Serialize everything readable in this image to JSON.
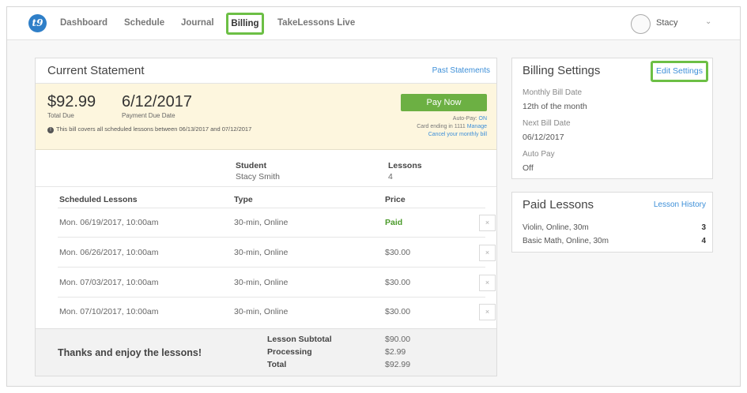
{
  "nav": {
    "logo": "t9",
    "items": [
      "Dashboard",
      "Schedule",
      "Journal",
      "Billing",
      "TakeLessons Live"
    ],
    "user": "Stacy"
  },
  "statement": {
    "title": "Current Statement",
    "past_link": "Past Statements",
    "total": "$92.99",
    "total_label": "Total Due",
    "due_date": "6/12/2017",
    "due_label": "Payment Due Date",
    "info": "This bill covers all scheduled lessons between 06/13/2017 and 07/12/2017",
    "pay_button": "Pay Now",
    "autopay_label": "Auto-Pay:",
    "autopay_state": "ON",
    "card_text": "Card ending in 1111",
    "manage": "Manage",
    "cancel": "Cancel your monthly bill",
    "student_label": "Student",
    "student_value": "Stacy Smith",
    "lessons_label": "Lessons",
    "lessons_value": "4",
    "columns": [
      "Scheduled Lessons",
      "Type",
      "Price"
    ],
    "rows": [
      {
        "date": "Mon. 06/19/2017, 10:00am",
        "type": "30-min, Online",
        "price": "Paid"
      },
      {
        "date": "Mon. 06/26/2017, 10:00am",
        "type": "30-min, Online",
        "price": "$30.00"
      },
      {
        "date": "Mon. 07/03/2017, 10:00am",
        "type": "30-min, Online",
        "price": "$30.00"
      },
      {
        "date": "Mon. 07/10/2017, 10:00am",
        "type": "30-min, Online",
        "price": "$30.00"
      }
    ],
    "remove_glyph": "×",
    "thanks": "Thanks and enjoy the lessons!",
    "subtotal_label": "Lesson Subtotal",
    "subtotal": "$90.00",
    "processing_label": "Processing",
    "processing": "$2.99",
    "total_label2": "Total",
    "total2": "$92.99"
  },
  "settings": {
    "title": "Billing Settings",
    "edit": "Edit Settings",
    "monthly_label": "Monthly Bill Date",
    "monthly_value": "12th of the month",
    "next_label": "Next Bill Date",
    "next_value": "06/12/2017",
    "autopay_label": "Auto Pay",
    "autopay_value": "Off"
  },
  "paid": {
    "title": "Paid Lessons",
    "history": "Lesson History",
    "items": [
      {
        "name": "Violin, Online, 30m",
        "count": "3"
      },
      {
        "name": "Basic Math, Online, 30m",
        "count": "4"
      }
    ]
  },
  "colors": {
    "accent_green": "#6cb043",
    "highlight_green": "#6cbf45",
    "link_blue": "#3d8fd8",
    "summary_bg": "#fdf6de"
  }
}
